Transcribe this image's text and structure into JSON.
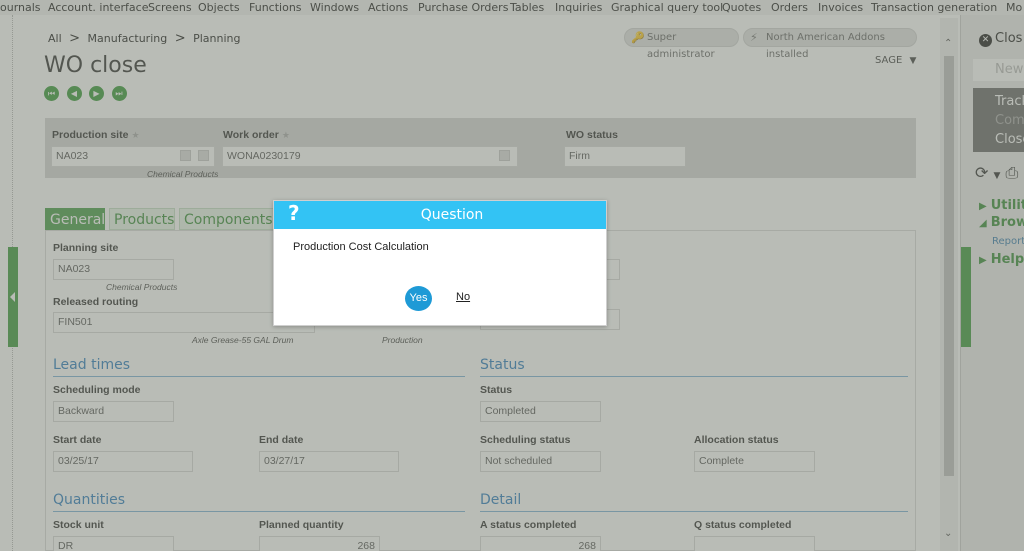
{
  "menu": [
    "ournals",
    "Account. interface",
    "Screens",
    "Objects",
    "Functions",
    "Windows",
    "Actions",
    "Purchase Orders",
    "Tables",
    "Inquiries",
    "Graphical query tool",
    "Quotes",
    "Orders",
    "Invoices",
    "Transaction generation",
    "Mo"
  ],
  "breadcrumb": {
    "all": "All",
    "sep": ">",
    "c1": "Manufacturing",
    "c2": "Planning"
  },
  "page_title": "WO close",
  "badges": {
    "user": "Super administrator",
    "addons": "North American Addons installed"
  },
  "company": "SAGE",
  "header": {
    "production_site": {
      "label": "Production site",
      "value": "NA023",
      "desc": "Chemical Products"
    },
    "work_order": {
      "label": "Work order",
      "value": "WONA0230179"
    },
    "wo_status": {
      "label": "WO status",
      "value": "Firm"
    }
  },
  "tabs": [
    "General",
    "Products",
    "Components"
  ],
  "general": {
    "planning_site": {
      "label": "Planning site",
      "value": "NA023",
      "desc": "Chemical Products"
    },
    "released_routing": {
      "label": "Released routing",
      "value": "FIN501",
      "desc1": "Axle Grease-55 GAL Drum",
      "desc2": "Production"
    },
    "lead_times": "Lead times",
    "scheduling_mode": {
      "label": "Scheduling mode",
      "value": "Backward"
    },
    "start_date": {
      "label": "Start date",
      "value": "03/25/17"
    },
    "end_date": {
      "label": "End date",
      "value": "03/27/17"
    },
    "status_section": "Status",
    "status": {
      "label": "Status",
      "value": "Completed"
    },
    "scheduling_status": {
      "label": "Scheduling status",
      "value": "Not scheduled"
    },
    "allocation_status": {
      "label": "Allocation status",
      "value": "Complete"
    },
    "quantities": "Quantities",
    "detail": "Detail",
    "stock_unit": {
      "label": "Stock unit",
      "value": "DR"
    },
    "planned_quantity": {
      "label": "Planned quantity",
      "value": "268"
    },
    "a_status_completed": {
      "label": "A status completed",
      "value": "268"
    },
    "q_status_completed": {
      "label": "Q status completed",
      "value": ""
    }
  },
  "right_panel": {
    "close": "Clos",
    "new": "New",
    "items": [
      "Track",
      "Com",
      "Close"
    ],
    "utilities": "Utilit",
    "browse": "Brow",
    "reports": "Reports",
    "help": "Help"
  },
  "dialog": {
    "icon": "?",
    "title": "Question",
    "message": "Production Cost Calculation",
    "yes": "Yes",
    "no": "No"
  },
  "colors": {
    "accent_green": "#3f9a3f",
    "dialog_header": "#33c3f4",
    "yes_button": "#1e9ad6",
    "section_blue": "#2f7fc1"
  }
}
